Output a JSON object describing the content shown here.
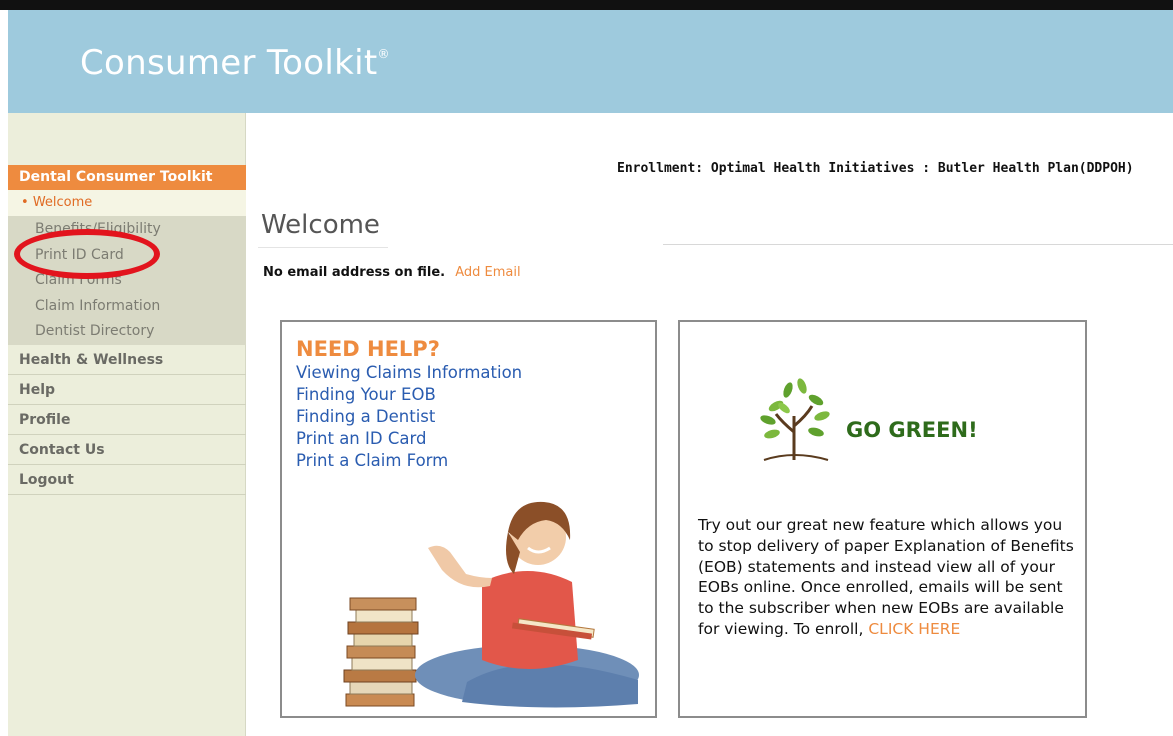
{
  "header": {
    "app_title": "Consumer Toolkit",
    "trademark": "®"
  },
  "sidebar": {
    "section_title": "Dental Consumer Toolkit",
    "active_item": "Welcome",
    "sub_items": [
      "Benefits/Eligibility",
      "Print ID Card",
      "Claim Forms",
      "Claim Information",
      "Dentist Directory"
    ],
    "main_items": [
      "Health & Wellness",
      "Help",
      "Profile",
      "Contact Us",
      "Logout"
    ]
  },
  "main": {
    "enrollment": "Enrollment:  Optimal Health Initiatives : Butler Health Plan(DDPOH)",
    "page_title": "Welcome",
    "no_email": "No email address on file.",
    "add_email": "Add Email"
  },
  "help_box": {
    "title": "NEED HELP?",
    "links": [
      "Viewing Claims Information",
      "Finding Your EOB",
      "Finding a Dentist",
      "Print an ID Card",
      "Print a Claim Form"
    ]
  },
  "green_box": {
    "title": "GO GREEN!",
    "text": "Try out our great new feature which allows you to stop delivery of paper Explanation of Benefits (EOB) statements and instead view all of your EOBs online. Once enrolled, emails will be sent to the subscriber when new EOBs are available for viewing. To enroll,",
    "cta": "CLICK HERE"
  },
  "colors": {
    "header_bg": "#9ecadd",
    "accent_orange": "#ee8b3f",
    "link_blue": "#2a5cb0",
    "highlight_red": "#e2141d",
    "green": "#2e6b1b"
  }
}
